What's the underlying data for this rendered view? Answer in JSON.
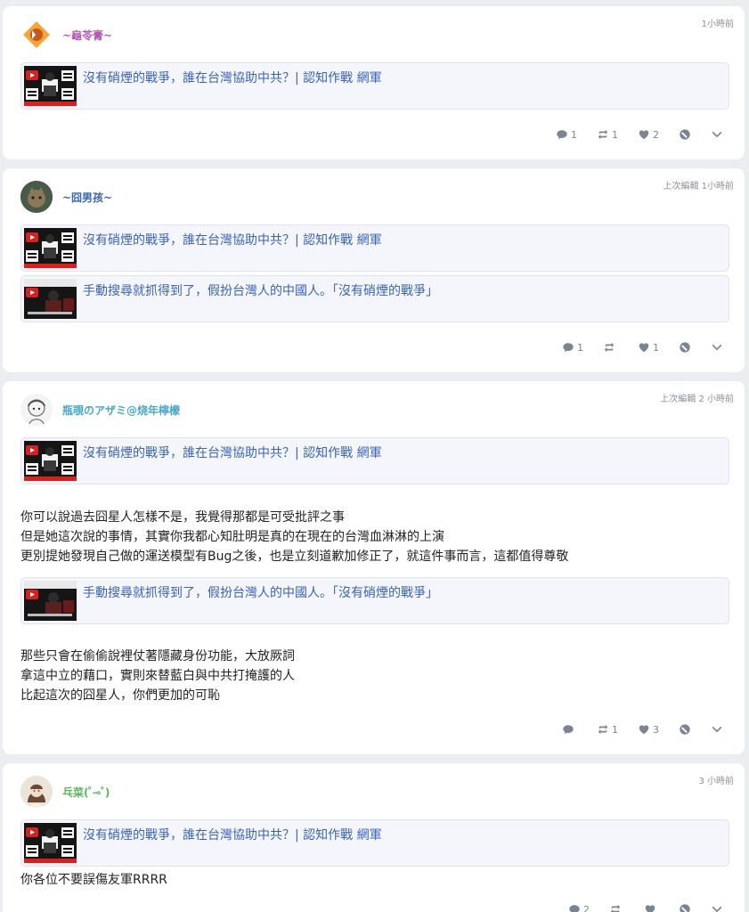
{
  "link_title_a": "沒有硝煙的戰爭，誰在台灣協助中共？| 認知作戰 網軍",
  "link_title_b": "手動搜尋就抓得到了，假扮台灣人的中國人。「沒有硝煙的戰爭」",
  "posts": [
    {
      "author": "~龜苓膏~",
      "author_color": "#b45ab4",
      "time": "1小時前",
      "actions": {
        "replies": "1",
        "reblogs": "1",
        "likes": "2"
      }
    },
    {
      "author": "~囧男孩~",
      "author_color": "#3a63b8",
      "time": "上次編輯 1小時前",
      "actions": {
        "replies": "1",
        "reblogs": "",
        "likes": "1"
      }
    },
    {
      "author": "瓶覗のアザミ@烧年檸檬",
      "author_color": "#4aa8c8",
      "time": "上次編輯 2 小時前",
      "paragraph1": [
        "你可以說過去囧星人怎樣不是，我覺得那都是可受批評之事",
        "但是她這次說的事情，其實你我都心知肚明是真的在現在的台灣血淋淋的上演",
        "更別提她發現自己做的運送模型有Bug之後，也是立刻道歉加修正了，就這件事而言，這都值得尊敬"
      ],
      "paragraph2": [
        "那些只會在偷偷說裡仗著隱藏身份功能，大放厥詞",
        "拿這中立的藉口，實則來替藍白與中共打掩護的人",
        "比起這次的囧星人，你們更加的可恥"
      ],
      "actions": {
        "replies": "",
        "reblogs": "1",
        "likes": "3"
      }
    },
    {
      "author": "乓菜( ̊⊸ ̊)",
      "author_color": "#5cb85c",
      "time": "3 小時前",
      "text": "你各位不要誤傷友軍RRRR",
      "actions": {
        "replies": "2",
        "reblogs": "",
        "likes": ""
      }
    }
  ]
}
